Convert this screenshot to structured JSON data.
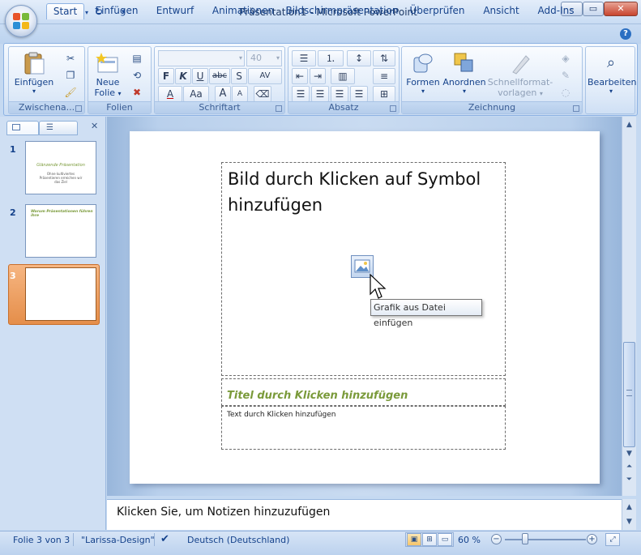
{
  "window": {
    "title": "Präsentation1 - Microsoft PowerPoint",
    "min": "–",
    "max": "▭",
    "close": "✕"
  },
  "tabs": [
    "Start",
    "Einfügen",
    "Entwurf",
    "Animationen",
    "Bildschirmpräsentation",
    "Überprüfen",
    "Ansicht",
    "Add-Ins"
  ],
  "ribbon": {
    "clipboard": {
      "label": "Zwischena...",
      "paste": "Einfügen"
    },
    "slides": {
      "label": "Folien",
      "new_line1": "Neue",
      "new_line2": "Folie"
    },
    "font": {
      "label": "Schriftart",
      "size": "40",
      "bold": "F",
      "italic": "K",
      "underline": "U",
      "strike": "abc",
      "shadow": "S",
      "spacing": "AV",
      "color": "A",
      "case": "Aa",
      "grow": "A",
      "shrink": "A"
    },
    "paragraph": {
      "label": "Absatz"
    },
    "drawing": {
      "label": "Zeichnung",
      "shapes": "Formen",
      "arrange": "Anordnen",
      "quick_line1": "Schnellformat-",
      "quick_line2": "vorlagen"
    },
    "edit": {
      "label": "Bearbeiten"
    }
  },
  "slides": [
    {
      "num": "1",
      "title": "Glänzende Präsentation",
      "sub": "Ohne kultiviertes Präsentieren erreichen wir das Ziel"
    },
    {
      "num": "2",
      "title": "Warum Präsentationen führen ihre"
    },
    {
      "num": "3"
    }
  ],
  "slide": {
    "picture_placeholder": "Bild durch Klicken auf Symbol hinzufügen",
    "tooltip": "Grafik aus Datei einfügen",
    "title_placeholder": "Titel durch Klicken hinzufügen",
    "text_placeholder": "Text durch Klicken hinzufügen"
  },
  "notes": {
    "placeholder": "Klicken Sie, um  Notizen hinzuzufügen"
  },
  "status": {
    "slide": "Folie 3 von 3",
    "design": "\"Larissa-Design\"",
    "language": "Deutsch (Deutschland)",
    "zoom": "60 %",
    "zoom_fraction": 0.25
  },
  "colors": {
    "accent": "#15428b",
    "placeholder_title": "#7a9a3a",
    "selected_thumb": "#e58e4a"
  }
}
